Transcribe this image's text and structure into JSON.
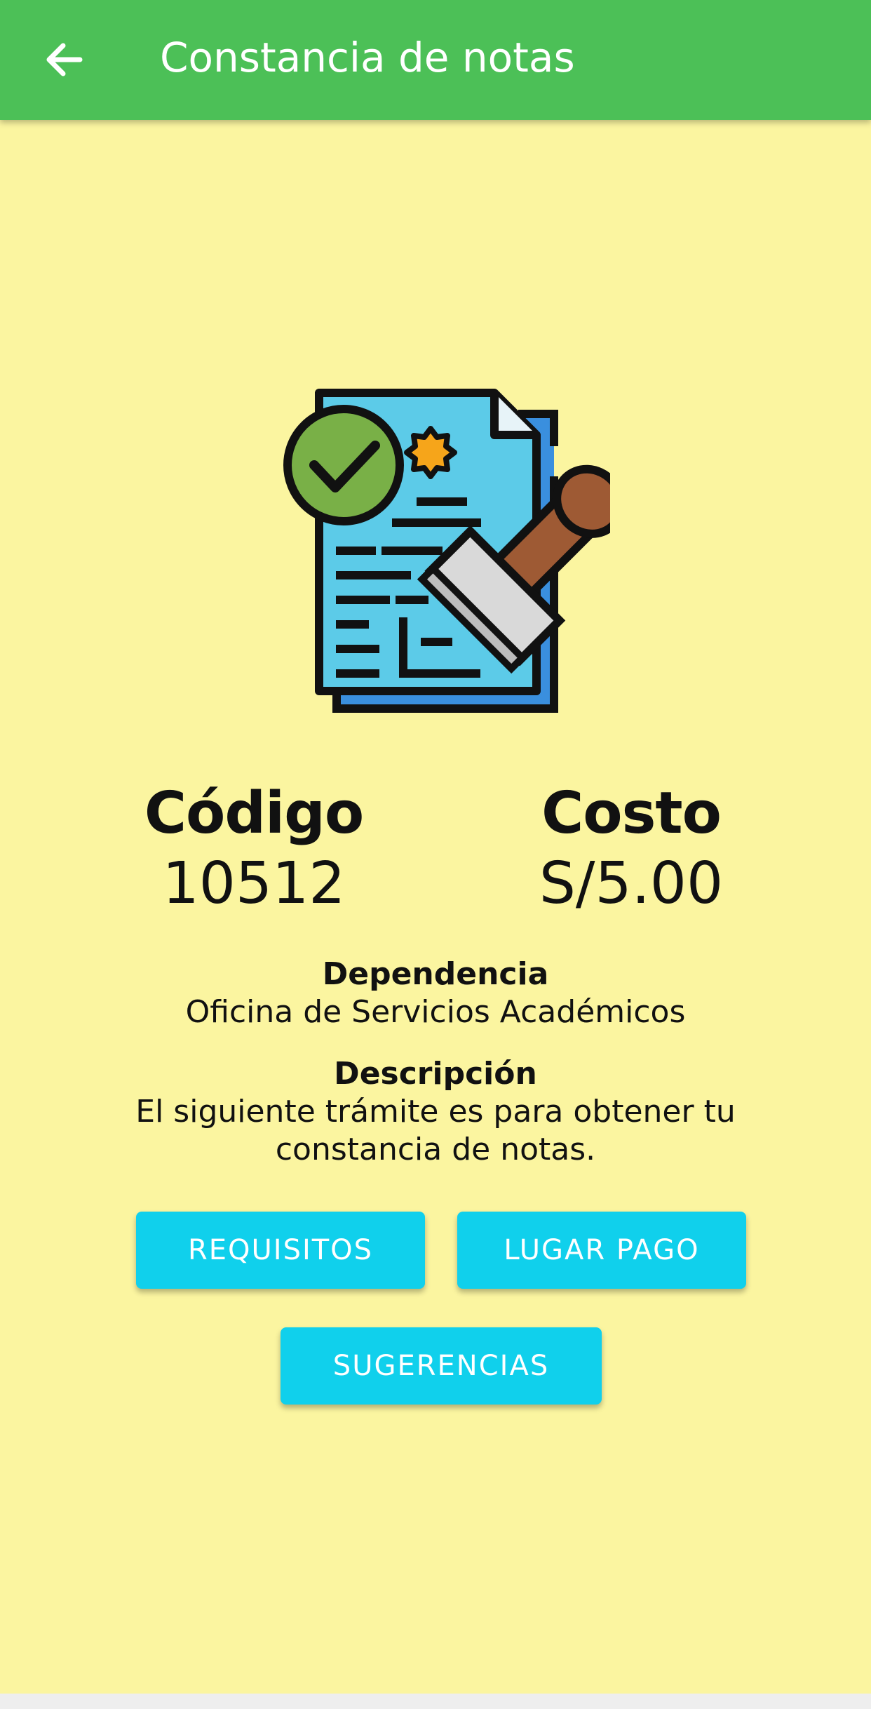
{
  "app_bar": {
    "title": "Constancia de notas",
    "back_icon": "arrow-left-icon"
  },
  "hero": {
    "icon": "certificate-document-icon",
    "colors": {
      "paper": "#5ccbe8",
      "paper_back": "#3a8fde",
      "check": "#79b047",
      "seal": "#f6a51a",
      "stamp_handle": "#9e5a34",
      "stamp_base": "#d9d9d9"
    }
  },
  "codigo": {
    "label": "Código",
    "value": "10512"
  },
  "costo": {
    "label": "Costo",
    "value": "S/5.00"
  },
  "dependencia": {
    "label": "Dependencia",
    "value": "Oficina de Servicios Académicos"
  },
  "descripcion": {
    "label": "Descripción",
    "line1": "El siguiente trámite es para obtener tu",
    "line2": "constancia de notas."
  },
  "buttons": {
    "requisitos": "REQUISITOS",
    "lugar_pago": "LUGAR PAGO",
    "sugerencias": "SUGERENCIAS"
  },
  "colors": {
    "app_bar": "#4cc057",
    "background": "#fbf5a0",
    "button": "#10d0ec"
  }
}
